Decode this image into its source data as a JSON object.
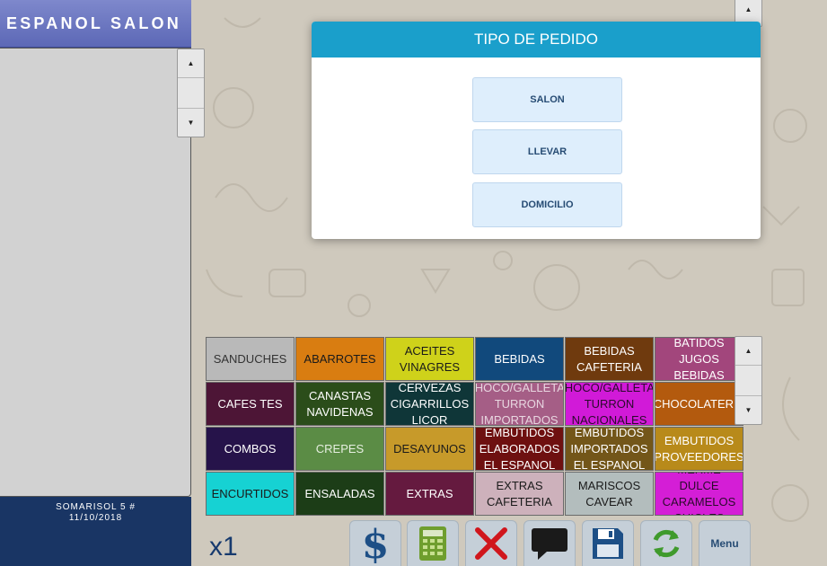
{
  "header": {
    "title": "ESPANOL SALON"
  },
  "info": {
    "line1": "SOMARISOL 5 #",
    "line2": "11/10/2018"
  },
  "multiplier": "x1",
  "dialog": {
    "title": "TIPO DE PEDIDO",
    "options": [
      "SALON",
      "LLEVAR",
      "DOMICILIO"
    ]
  },
  "categories": [
    {
      "label": "SANDUCHES",
      "bg": "#b9b9b9",
      "fg": "#333333"
    },
    {
      "label": "ABARROTES",
      "bg": "#d97d11",
      "fg": "#1a1a1a"
    },
    {
      "label": "ACEITES VINAGRES",
      "bg": "#cfd21a",
      "fg": "#1a1a1a"
    },
    {
      "label": "BEBIDAS",
      "bg": "#11497c",
      "fg": "#ffffff"
    },
    {
      "label": "BEBIDAS CAFETERIA",
      "bg": "#6f3a0e",
      "fg": "#ffffff"
    },
    {
      "label": "BATIDOS JUGOS BEBIDAS",
      "bg": "#a2467c",
      "fg": "#ffffff"
    },
    {
      "label": "CAFES TES",
      "bg": "#4d1536",
      "fg": "#ffffff"
    },
    {
      "label": "CANASTAS NAVIDENAS",
      "bg": "#2b4d1a",
      "fg": "#ffffff"
    },
    {
      "label": "CERVEZAS CIGARRILLOS LICOR",
      "bg": "#0f3638",
      "fg": "#ffffff"
    },
    {
      "label": "CHOCO/GALLETAS TURRON IMPORTADOS",
      "bg": "#a55e86",
      "fg": "#e8d6e0"
    },
    {
      "label": "CHOCO/GALLETAS TURRON NACIONALES",
      "bg": "#d11ad8",
      "fg": "#2b0a2c"
    },
    {
      "label": "CHOCOLATERIA",
      "bg": "#b35a0e",
      "fg": "#ffffff"
    },
    {
      "label": "COMBOS",
      "bg": "#26134a",
      "fg": "#ffffff"
    },
    {
      "label": "CREPES",
      "bg": "#5b8c45",
      "fg": "#e6efe0"
    },
    {
      "label": "DESAYUNOS",
      "bg": "#c79a2a",
      "fg": "#1a1a1a"
    },
    {
      "label": "EMBUTIDOS ELABORADOS EL ESPANOL",
      "bg": "#6e1010",
      "fg": "#ffffff"
    },
    {
      "label": "EMBUTIDOS IMPORTADOS EL ESPANOL",
      "bg": "#735619",
      "fg": "#ffffff"
    },
    {
      "label": "EMBUTIDOS PROVEEDORES",
      "bg": "#b88a1a",
      "fg": "#ffffff"
    },
    {
      "label": "ENCURTIDOS",
      "bg": "#16d2d3",
      "fg": "#1a1a1a"
    },
    {
      "label": "ENSALADAS",
      "bg": "#1c3d17",
      "fg": "#ffffff"
    },
    {
      "label": "EXTRAS",
      "bg": "#651a3f",
      "fg": "#ffffff"
    },
    {
      "label": "EXTRAS CAFETERIA",
      "bg": "#cdb1bb",
      "fg": "#1a1a1a"
    },
    {
      "label": "MARISCOS CAVEAR",
      "bg": "#b3bdbd",
      "fg": "#1a1a1a"
    },
    {
      "label": "MERME DULCE CARAMELOS CHICLES",
      "bg": "#d41ed6",
      "fg": "#2b0a2c"
    }
  ],
  "toolbar": {
    "menu_label": "Menu",
    "icons": [
      "dollar-icon",
      "calculator-icon",
      "cancel-x-icon",
      "comment-icon",
      "save-icon",
      "refresh-icon"
    ]
  },
  "colors": {
    "header": "#6470bb",
    "dialog_title": "#1a9fcb",
    "info_panel": "#193564"
  }
}
